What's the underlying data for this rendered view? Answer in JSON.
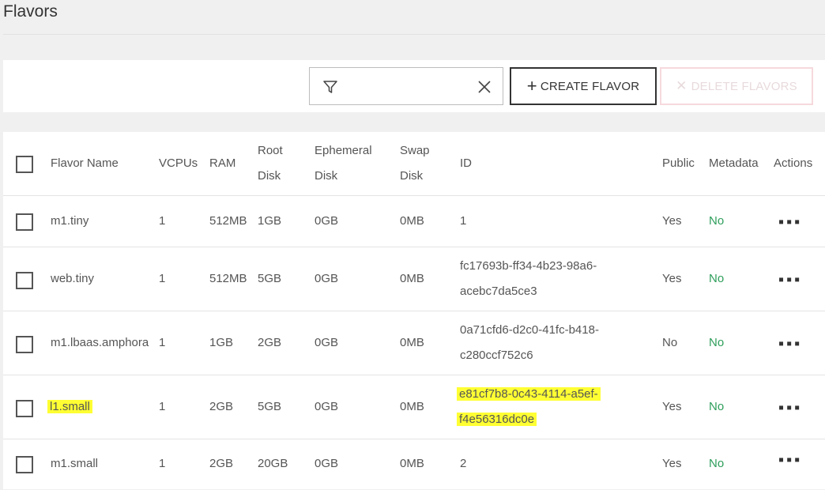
{
  "page": {
    "title": "Flavors"
  },
  "toolbar": {
    "filter_placeholder": "",
    "create_label": "CREATE FLAVOR",
    "delete_label": "DELETE FLAVORS"
  },
  "table": {
    "headers": {
      "name": "Flavor Name",
      "vcpus": "VCPUs",
      "ram": "RAM",
      "root_disk_1": "Root",
      "root_disk_2": "Disk",
      "ephemeral_disk_1": "Ephemeral",
      "ephemeral_disk_2": "Disk",
      "swap_disk_1": "Swap",
      "swap_disk_2": "Disk",
      "id": "ID",
      "public": "Public",
      "metadata": "Metadata",
      "actions": "Actions"
    },
    "rows": [
      {
        "name": "m1.tiny",
        "vcpus": "1",
        "ram": "512MB",
        "root": "1GB",
        "ephemeral": "0GB",
        "swap": "0MB",
        "id1": "1",
        "id2": "",
        "public": "Yes",
        "metadata": "No"
      },
      {
        "name": "web.tiny",
        "vcpus": "1",
        "ram": "512MB",
        "root": "5GB",
        "ephemeral": "0GB",
        "swap": "0MB",
        "id1": "fc17693b-ff34-4b23-98a6-",
        "id2": "acebc7da5ce3",
        "public": "Yes",
        "metadata": "No"
      },
      {
        "name": "m1.lbaas.amphora",
        "vcpus": "1",
        "ram": "1GB",
        "root": "2GB",
        "ephemeral": "0GB",
        "swap": "0MB",
        "id1": "0a71cfd6-d2c0-41fc-b418-",
        "id2": "c280ccf752c6",
        "public": "No",
        "metadata": "No"
      },
      {
        "name": "l1.small",
        "vcpus": "1",
        "ram": "2GB",
        "root": "5GB",
        "ephemeral": "0GB",
        "swap": "0MB",
        "id1": "e81cf7b8-0c43-4114-a5ef-",
        "id2": "f4e56316dc0e",
        "public": "Yes",
        "metadata": "No"
      },
      {
        "name": "m1.small",
        "vcpus": "1",
        "ram": "2GB",
        "root": "20GB",
        "ephemeral": "0GB",
        "swap": "0MB",
        "id1": "2",
        "id2": "",
        "public": "Yes",
        "metadata": "No"
      }
    ],
    "actions_glyph": "▪▪▪"
  },
  "colors": {
    "metadata_no": "#2e9e5b",
    "highlight": "#ffff33",
    "delete_disabled": "#f6d9dd"
  }
}
